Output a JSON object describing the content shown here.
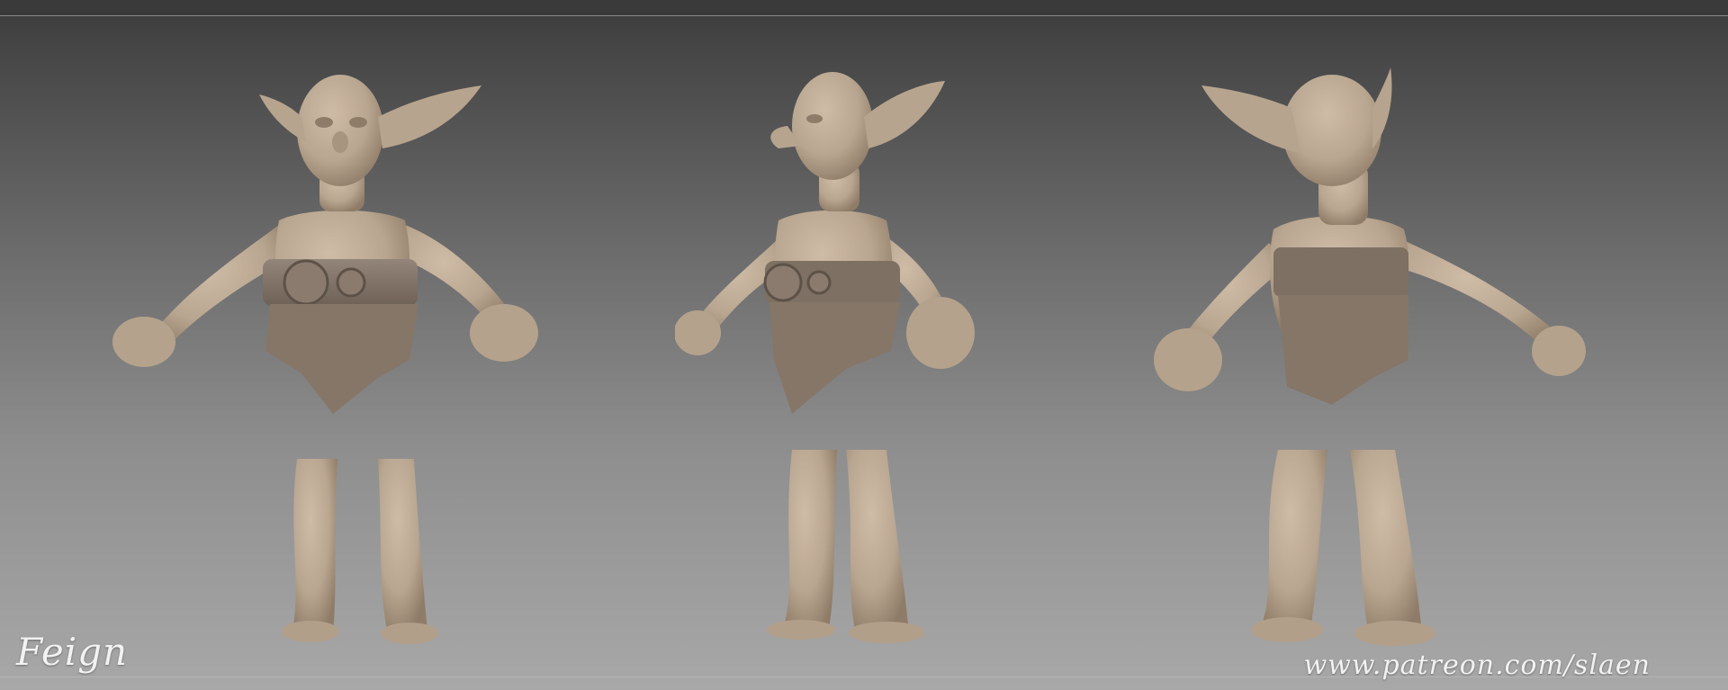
{
  "caption": {
    "title": "Feign",
    "url": "www.patreon.com/slaen"
  },
  "colors": {
    "skin": "#b9a690",
    "skin_shadow": "#8f7c68",
    "belt": "#7e7062",
    "loincloth": "#857668",
    "background_top": "#3b3b3b",
    "background_bottom": "#a8a8a8"
  },
  "views": [
    {
      "id": "front",
      "name": "goblin-front-view"
    },
    {
      "id": "side",
      "name": "goblin-side-view"
    },
    {
      "id": "back",
      "name": "goblin-back-view"
    }
  ]
}
